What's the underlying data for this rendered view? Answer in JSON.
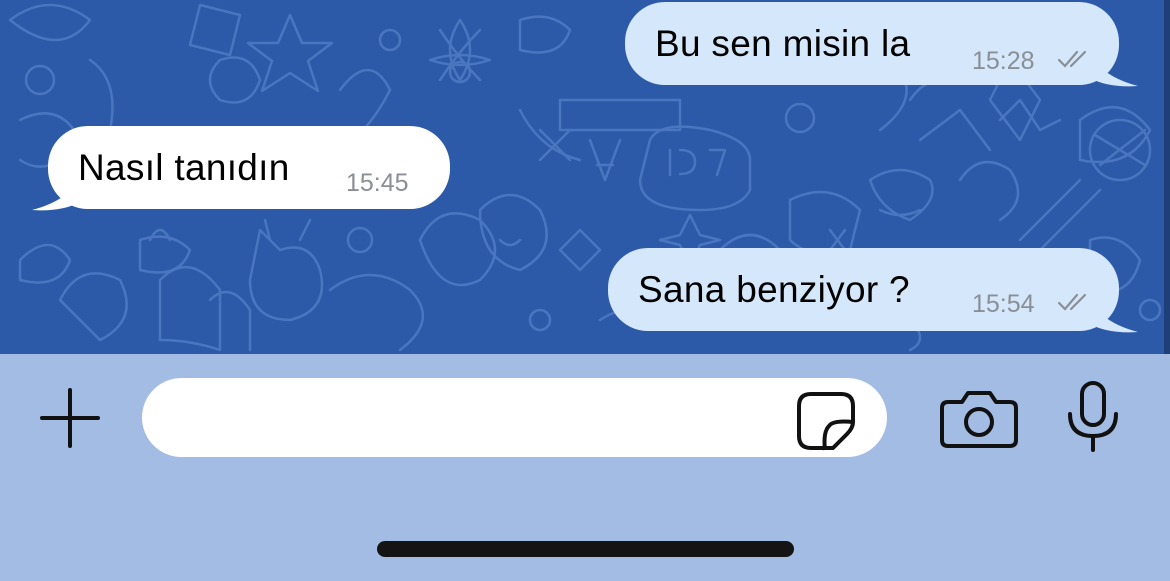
{
  "colors": {
    "chat_background": "#2c5aa8",
    "outgoing_bubble": "#d5e7fb",
    "incoming_bubble": "#ffffff",
    "input_bar": "#a3bce3",
    "timestamp": "#8a8f96"
  },
  "messages": [
    {
      "direction": "outgoing",
      "text": "Bu sen misin la",
      "time": "15:28",
      "status_icon": "double-check-icon"
    },
    {
      "direction": "incoming",
      "text": "Nasıl tanıdın",
      "time": "15:45"
    },
    {
      "direction": "outgoing",
      "text": "Sana benziyor ?",
      "time": "15:54",
      "status_icon": "double-check-icon"
    }
  ],
  "input_bar": {
    "message_value": "",
    "attach_icon": "plus-icon",
    "sticker_icon": "sticker-icon",
    "camera_icon": "camera-icon",
    "voice_icon": "microphone-icon"
  }
}
